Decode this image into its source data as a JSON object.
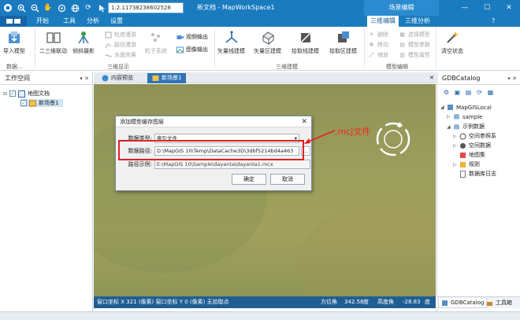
{
  "app": {
    "title": "新文档 - MapWorkSpace1",
    "scale_value": "1:2.11738238602528",
    "context_header": "场景编辑"
  },
  "ribbon_tabs": [
    {
      "label": "开始"
    },
    {
      "label": "工具"
    },
    {
      "label": "分析"
    },
    {
      "label": "设置"
    },
    {
      "label": "三维编辑"
    },
    {
      "label": "三维分析"
    }
  ],
  "ribbon": {
    "groups": {
      "data": "数据...",
      "display3d": "三维显示",
      "build3d": "三维建模",
      "model_edit": "模型编辑"
    },
    "import_model": "导入模型",
    "link_2d3d": "二三维联动",
    "tilt_photo": "倾斜摄影",
    "track_roam": "轨迹漫游",
    "path_roam": "路径漫游",
    "water_effect": "水面效果",
    "particle_system": "粒子系统",
    "video_output": "视频输出",
    "image_output": "图像输出",
    "vector_line_build": "矢量线建模",
    "vector_area_build": "矢量区建模",
    "pick_line_build": "拾取线建模",
    "pick_area_build": "拾取区建模",
    "delete": "删除",
    "move": "移动",
    "scale": "缩放",
    "select_model": "选择模型",
    "model_params": "模型参数",
    "model_attrs": "模型属性",
    "clear_state": "清空状态"
  },
  "left_panel": {
    "title": "工作空间",
    "tree": {
      "root": "地图文档",
      "child": "新场景1"
    }
  },
  "doc_tabs": [
    {
      "label": "内容预览"
    },
    {
      "label": "新场景1"
    }
  ],
  "dialog": {
    "title": "添加模型缓存图层",
    "data_type_label": "数据类型:",
    "data_type_value": "索引文件",
    "data_path_label": "数据路径:",
    "data_path_value": "D:\\MapGIS 10\\Temp\\DataCache3D\\3dbf5214bd4a463",
    "path_example_label": "路径示例:",
    "path_example_value": "E:\\MapGIS 10\\Sample\\dayanta\\dayanta1.mcx",
    "ok": "确定",
    "cancel": "取消",
    "browse": "..."
  },
  "annotation": ".mcj文件",
  "status_bar": {
    "coord": "窗口坐标 X 321 (像素) 窗口坐标 Y 0 (像素) 无拾取点",
    "azimuth_label": "方位角",
    "azimuth_value": "342.58",
    "unit_deg": "度",
    "elevation_label": "高度角",
    "elevation_value": "-28.83",
    "unit_deg2": "度"
  },
  "right_panel": {
    "title": "GDBCatalog",
    "items": {
      "root": "MapGISLocal",
      "sample": "sample",
      "example_data": "示例数据",
      "spatial_ref": "空间参照系",
      "spatial_data": "空间数据",
      "map_set": "地图集",
      "rules": "规则",
      "db_log": "数据库日志"
    }
  },
  "bottom_tabs": [
    {
      "label": "GDBCatalog"
    },
    {
      "label": "工具箱"
    }
  ],
  "colors": {
    "title_bar": "#1a7bbf",
    "status_bar": "#1f5e93",
    "highlight": "#e02020",
    "annotation": "#ff2020"
  }
}
